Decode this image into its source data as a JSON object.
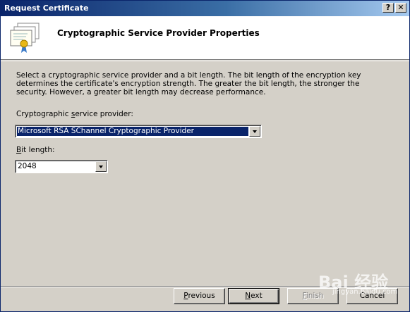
{
  "window": {
    "title": "Request Certificate",
    "help_label": "?",
    "close_label": "✕"
  },
  "header": {
    "title": "Cryptographic Service Provider Properties",
    "icon": "certificate-icon"
  },
  "description": "Select a cryptographic service provider and a bit length. The bit length of the encryption key determines the certificate's encryption strength. The greater the bit length, the stronger the security. However, a greater bit length may decrease performance.",
  "provider": {
    "label_pre": "Cryptographic ",
    "label_accel": "s",
    "label_post": "ervice provider:",
    "value": "Microsoft RSA SChannel Cryptographic Provider"
  },
  "bits": {
    "label_accel": "B",
    "label_post": "it length:",
    "value": "2048"
  },
  "buttons": {
    "previous_accel": "P",
    "previous_rest": "revious",
    "next_accel": "N",
    "next_rest": "ext",
    "finish_accel": "F",
    "finish_rest": "inish",
    "cancel": "Cancel"
  },
  "watermark": {
    "text": "Bai 经验",
    "url": "jingyan.baidu.com"
  },
  "colors": {
    "titlebar_start": "#0a246a",
    "titlebar_end": "#a6caf0",
    "face": "#d4d0c8",
    "selection": "#0a246a"
  }
}
